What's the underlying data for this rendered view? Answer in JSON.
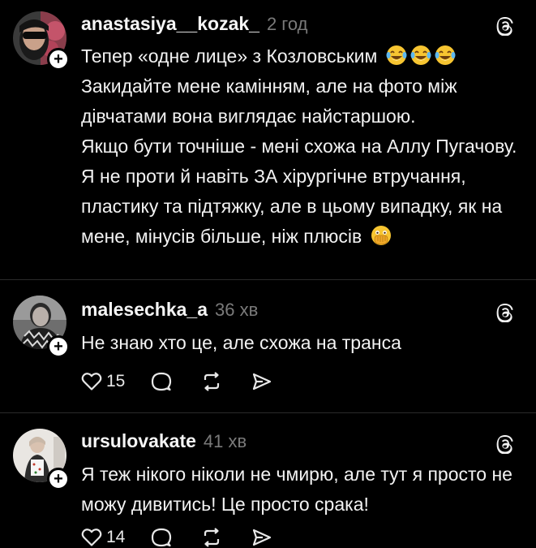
{
  "posts": [
    {
      "username": "anastasiya__kozak_",
      "time": "2 год",
      "paragraphs": [
        "Тепер «одне лице» з Козловським",
        "Закидайте мене камінням, але на фото між дівчатами вона виглядає найстаршою.",
        "Якщо бути точніше - мені схожа на Аллу Пугачову.",
        "Я не проти й навіть ЗА хірургічне втручання, пластику та підтяжку, але в цьому випадку, як на мене, мінусів більше, ніж плюсів"
      ],
      "emojis": [
        "face-with-tears-of-joy",
        "face-with-tears-of-joy",
        "face-with-tears-of-joy",
        "face-with-open-eyes-and-hand-over-mouth"
      ]
    },
    {
      "username": "malesechka_a",
      "time": "36 хв",
      "paragraphs": [
        "Не знаю хто це, але схожа на транса"
      ],
      "likes": "15"
    },
    {
      "username": "ursulovakate",
      "time": "41 хв",
      "paragraphs": [
        "Я теж нікого ніколи не чмирю, але тут я просто не можу дивитись! Це просто срака!"
      ],
      "likes": "14"
    }
  ],
  "icons": {
    "follow": "plus-icon",
    "brand": "threads-icon",
    "like": "heart-icon",
    "reply": "comment-icon",
    "repost": "repost-icon",
    "share": "send-icon"
  },
  "colors": {
    "background": "#000000",
    "text": "#f2f2f2",
    "secondary": "#7a7a7a",
    "divider": "#2b2b2b",
    "emoji": "#f7c531"
  },
  "follow_glyph": "+"
}
